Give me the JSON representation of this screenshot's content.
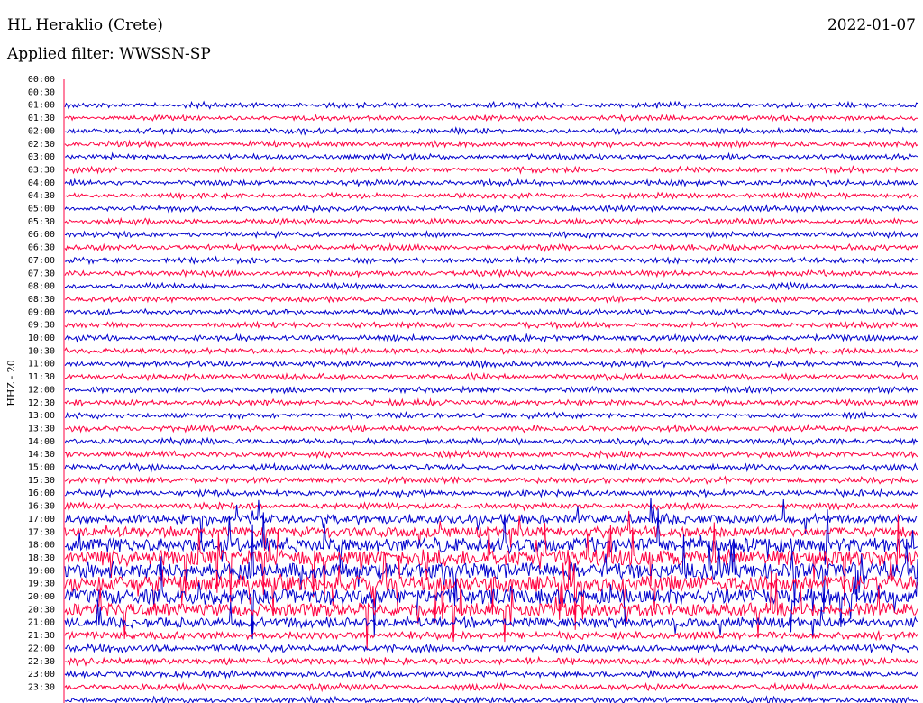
{
  "header": {
    "station": "HL Heraklio (Crete)",
    "date": "2022-01-07",
    "filter": "Applied filter: WWSSN-SP"
  },
  "chart_data": {
    "type": "line",
    "title": "HL Heraklio (Crete)",
    "channel_label": "HHZ - 20",
    "ylabel": "HHZ - 20",
    "time_ticks": [
      "00:00",
      "00:30",
      "01:00",
      "01:30",
      "02:00",
      "02:30",
      "03:00",
      "03:30",
      "04:00",
      "04:30",
      "05:00",
      "05:30",
      "06:00",
      "06:30",
      "07:00",
      "07:30",
      "08:00",
      "08:30",
      "09:00",
      "09:30",
      "10:00",
      "10:30",
      "11:00",
      "11:30",
      "12:00",
      "12:30",
      "13:00",
      "13:30",
      "14:00",
      "14:30",
      "15:00",
      "15:30",
      "16:00",
      "16:30",
      "17:00",
      "17:30",
      "18:00",
      "18:30",
      "19:00",
      "19:30",
      "20:00",
      "20:30",
      "21:00",
      "21:30",
      "22:00",
      "22:30",
      "23:00",
      "23:30"
    ],
    "trace_colors": [
      "#0000cc",
      "#ff0040"
    ],
    "trace_activity": [
      0,
      0,
      0.15,
      0.12,
      0.15,
      0.14,
      0.14,
      0.14,
      0.14,
      0.14,
      0.14,
      0.14,
      0.14,
      0.15,
      0.15,
      0.15,
      0.16,
      0.15,
      0.16,
      0.16,
      0.18,
      0.17,
      0.16,
      0.17,
      0.16,
      0.17,
      0.16,
      0.17,
      0.17,
      0.18,
      0.2,
      0.2,
      0.2,
      0.2,
      0.45,
      0.55,
      0.85,
      1.0,
      1.0,
      1.0,
      0.95,
      0.8,
      0.5,
      0.35,
      0.3,
      0.25,
      0.2,
      0.18
    ],
    "grid": false
  }
}
